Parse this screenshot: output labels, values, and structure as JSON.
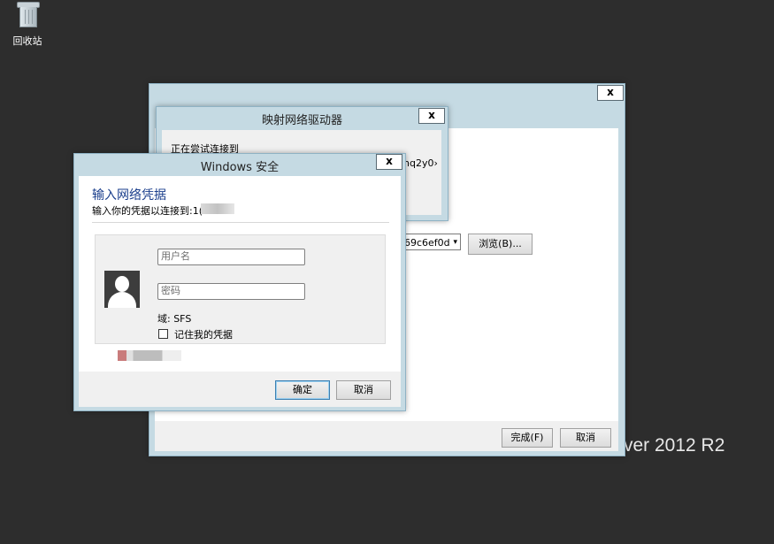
{
  "desktop": {
    "recycle_bin_label": "回收站",
    "branding_text": "ver 2012 R2"
  },
  "wizard": {
    "close_glyph": "x",
    "folder_value": "69c6ef0d",
    "browse_label": "浏览(B)...",
    "finish_label": "完成(F)",
    "cancel_label": "取消"
  },
  "progress_dialog": {
    "title": "映射网络驱动器",
    "close_glyph": "x",
    "connecting_label": "正在尝试连接到",
    "target_partial": "hq2y0›"
  },
  "credentials_dialog": {
    "title": "Windows 安全",
    "close_glyph": "x",
    "heading": "输入网络凭据",
    "subheading": "输入你的凭据以连接到:1(",
    "username_placeholder": "用户名",
    "password_placeholder": "密码",
    "domain_label": "域: SFS",
    "remember_label": "记住我的凭据",
    "ok_label": "确定",
    "cancel_label": "取消"
  },
  "colors": {
    "desktop_bg": "#2d2d2d",
    "window_frame": "#c5dae3",
    "heading_blue": "#1a3e8c"
  },
  "icons": [
    "recycle-bin-icon",
    "user-avatar-icon",
    "close-icon",
    "checkbox-icon",
    "dropdown-arrow-icon"
  ]
}
